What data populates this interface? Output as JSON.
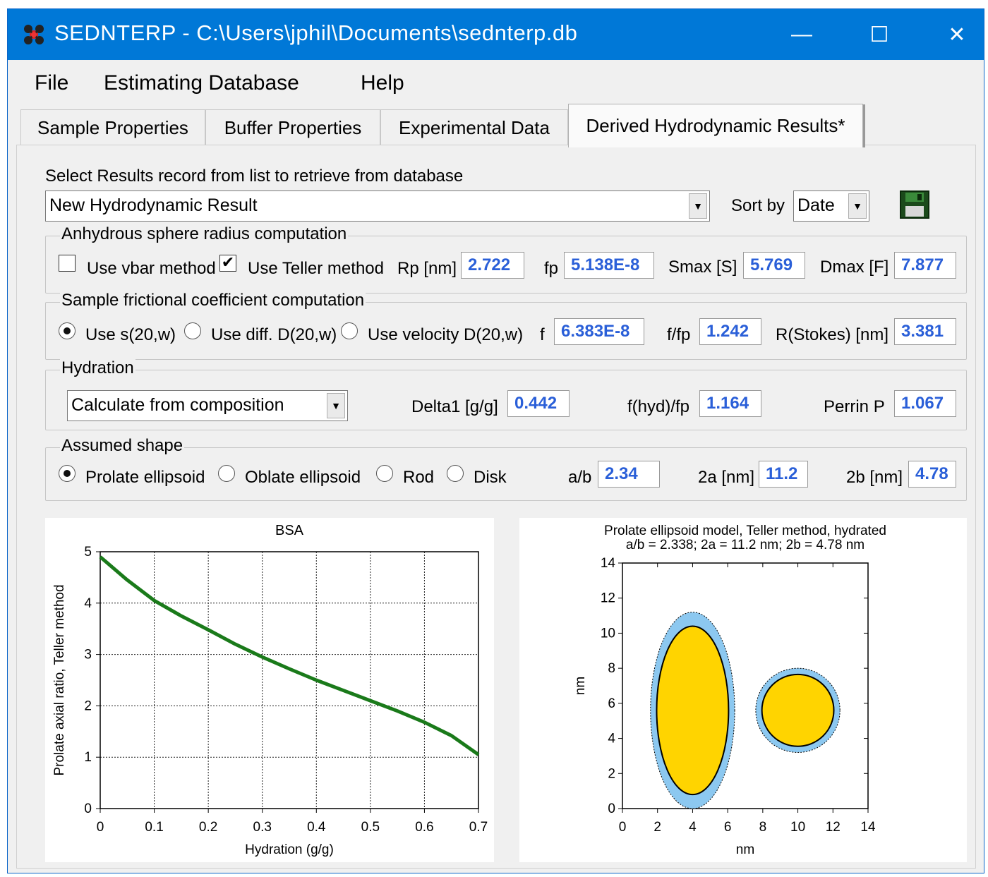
{
  "window": {
    "title": "SEDNTERP - C:\\Users\\jphil\\Documents\\sednterp.db",
    "minimize": "—",
    "maximize": "☐",
    "close": "✕",
    "titlebar_color": "#0078d7"
  },
  "menu": [
    "File",
    "Estimating Database",
    "Help"
  ],
  "tabs": [
    "Sample Properties",
    "Buffer Properties",
    "Experimental Data",
    "Derived Hydrodynamic Results*"
  ],
  "active_tab": 3,
  "record": {
    "prompt": "Select Results record from list to retrieve from database",
    "selected": "New Hydrodynamic Result",
    "sort_label": "Sort by",
    "sort_value": "Date",
    "save_icon": "floppy-disk-icon"
  },
  "anhydrous": {
    "title": "Anhydrous sphere radius computation",
    "vbar_label": "Use vbar method",
    "vbar_checked": false,
    "teller_label": "Use Teller method",
    "teller_checked": true,
    "rp_label": "Rp [nm]",
    "rp": "2.722",
    "fp_label": "fp",
    "fp": "5.138E-8",
    "smax_label": "Smax [S]",
    "smax": "5.769",
    "dmax_label": "Dmax [F]",
    "dmax": "7.877"
  },
  "frictional": {
    "title": "Sample frictional coefficient computation",
    "options": [
      "Use s(20,w)",
      "Use diff. D(20,w)",
      "Use velocity D(20,w)"
    ],
    "selected": 0,
    "f_label": "f",
    "f": "6.383E-8",
    "ffp_label": "f/fp",
    "ffp": "1.242",
    "rstokes_label": "R(Stokes) [nm]",
    "rstokes": "3.381"
  },
  "hydration": {
    "title": "Hydration",
    "method": "Calculate from composition",
    "delta_label": "Delta1 [g/g]",
    "delta": "0.442",
    "fhyd_label": "f(hyd)/fp",
    "fhyd": "1.164",
    "perrin_label": "Perrin P",
    "perrin": "1.067"
  },
  "shape": {
    "title": "Assumed shape",
    "options": [
      "Prolate ellipsoid",
      "Oblate ellipsoid",
      "Rod",
      "Disk"
    ],
    "selected": 0,
    "ab_label": "a/b",
    "ab": "2.34",
    "a2_label": "2a [nm]",
    "a2": "11.2",
    "b2_label": "2b [nm]",
    "b2": "4.78"
  },
  "colors": {
    "value_text": "#2a5fd8",
    "curve": "#1a7a1a",
    "hydration_shell": "#8cc8f0",
    "core": "#ffd400"
  },
  "chart_data": [
    {
      "type": "line",
      "title": "BSA",
      "xlabel": "Hydration (g/g)",
      "ylabel": "Prolate axial ratio, Teller method",
      "xlim": [
        0,
        0.7
      ],
      "ylim": [
        0,
        5
      ],
      "grid": true,
      "x_ticks": [
        "0",
        "0.1",
        "0.2",
        "0.3",
        "0.4",
        "0.5",
        "0.6",
        "0.7"
      ],
      "y_ticks": [
        "0",
        "1",
        "2",
        "3",
        "4",
        "5"
      ],
      "x": [
        0,
        0.05,
        0.1,
        0.15,
        0.2,
        0.25,
        0.3,
        0.35,
        0.4,
        0.45,
        0.5,
        0.55,
        0.6,
        0.65,
        0.7
      ],
      "y": [
        4.9,
        4.45,
        4.05,
        3.75,
        3.48,
        3.2,
        2.95,
        2.72,
        2.5,
        2.3,
        2.1,
        1.9,
        1.68,
        1.42,
        1.05
      ]
    },
    {
      "type": "scatter",
      "title": "Prolate ellipsoid model, Teller method, hydrated",
      "subtitle": "a/b = 2.338; 2a = 11.2 nm; 2b = 4.78 nm",
      "xlabel": "nm",
      "ylabel": "nm",
      "xlim": [
        0,
        14
      ],
      "ylim": [
        0,
        14
      ],
      "x_ticks": [
        "0",
        "2",
        "4",
        "6",
        "8",
        "10",
        "12",
        "14"
      ],
      "y_ticks": [
        "0",
        "2",
        "4",
        "6",
        "8",
        "10",
        "12",
        "14"
      ],
      "shapes": [
        {
          "name": "side view hydrated",
          "cx": 4,
          "cy": 5.6,
          "rx": 2.4,
          "ry": 5.6
        },
        {
          "name": "side view anhydrous",
          "cx": 4,
          "cy": 5.6,
          "rx": 2.05,
          "ry": 4.8
        },
        {
          "name": "end view hydrated",
          "cx": 10,
          "cy": 5.6,
          "rx": 2.4,
          "ry": 2.4
        },
        {
          "name": "end view anhydrous",
          "cx": 10,
          "cy": 5.6,
          "rx": 2.05,
          "ry": 2.05
        }
      ]
    }
  ]
}
